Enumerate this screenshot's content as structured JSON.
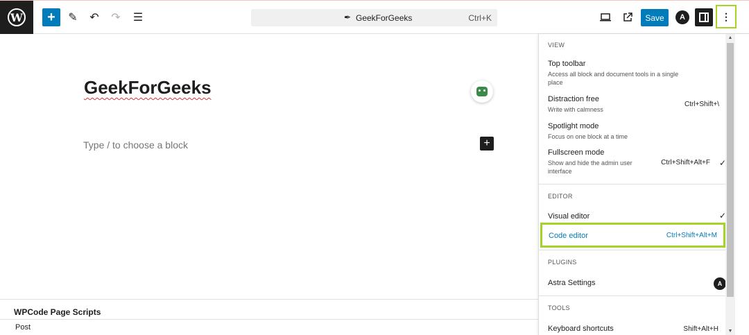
{
  "brand": {
    "logo_letter": "W",
    "accent": "#007cba",
    "highlight": "#a6d426"
  },
  "toolbar": {
    "add_icon": "+",
    "tools_icon": "✎",
    "undo_icon": "↶",
    "redo_icon": "↷",
    "list_icon": "☰",
    "command_title": "GeekForGeeks",
    "command_shortcut": "Ctrl+K",
    "preview_icon": "laptop-icon",
    "external_icon": "external-link-icon",
    "save_label": "Save",
    "astra_letter": "A",
    "options_icon": "⋮"
  },
  "editor": {
    "post_title": "GeekForGeeks",
    "block_placeholder": "Type / to choose a block",
    "add_block_icon": "+"
  },
  "footer": {
    "metabox_title": "WPCode Page Scripts",
    "breadcrumb": "Post"
  },
  "menu": {
    "view": {
      "title": "VIEW",
      "items": [
        {
          "label": "Top toolbar",
          "desc": "Access all block and document tools in a single place",
          "shortcut": "",
          "checked": false
        },
        {
          "label": "Distraction free",
          "desc": "Write with calmness",
          "shortcut": "Ctrl+Shift+\\",
          "checked": false
        },
        {
          "label": "Spotlight mode",
          "desc": "Focus on one block at a time",
          "shortcut": "",
          "checked": false
        },
        {
          "label": "Fullscreen mode",
          "desc": "Show and hide the admin user interface",
          "shortcut": "Ctrl+Shift+Alt+F",
          "checked": true
        }
      ]
    },
    "editor": {
      "title": "EDITOR",
      "visual_label": "Visual editor",
      "visual_check": "✓",
      "code_label": "Code editor",
      "code_shortcut": "Ctrl+Shift+Alt+M"
    },
    "plugins": {
      "title": "PLUGINS",
      "astra_label": "Astra Settings",
      "astra_letter": "A"
    },
    "tools": {
      "title": "TOOLS",
      "shortcuts_label": "Keyboard shortcuts",
      "shortcuts_shortcut": "Shift+Alt+H"
    }
  },
  "check_mark": "✓"
}
